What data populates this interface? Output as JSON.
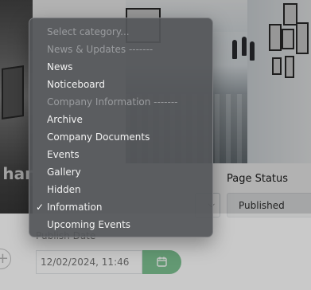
{
  "background": {
    "left_heading_fragment": "har",
    "page_status": {
      "label": "Page Status",
      "value": "Published"
    },
    "publish_date": {
      "label": "Publish Date",
      "value": "12/02/2024, 11:46"
    },
    "colors": {
      "date_button": "#2e9e4f"
    }
  },
  "dropdown": {
    "selected": "Information",
    "options": [
      {
        "label": "Select category...",
        "disabled": true
      },
      {
        "label": "News & Updates -------",
        "disabled": true
      },
      {
        "label": "News",
        "disabled": false
      },
      {
        "label": "Noticeboard",
        "disabled": false
      },
      {
        "label": "Company Information -------",
        "disabled": true
      },
      {
        "label": "Archive",
        "disabled": false
      },
      {
        "label": "Company Documents",
        "disabled": false
      },
      {
        "label": "Events",
        "disabled": false
      },
      {
        "label": "Gallery",
        "disabled": false
      },
      {
        "label": "Hidden",
        "disabled": false
      },
      {
        "label": "Information",
        "disabled": false
      },
      {
        "label": "Upcoming Events",
        "disabled": false
      }
    ],
    "check_glyph": "✓"
  },
  "icons": {
    "category_select_chevron": "chevron-down-icon",
    "date_button_icon": "calendar-icon"
  }
}
